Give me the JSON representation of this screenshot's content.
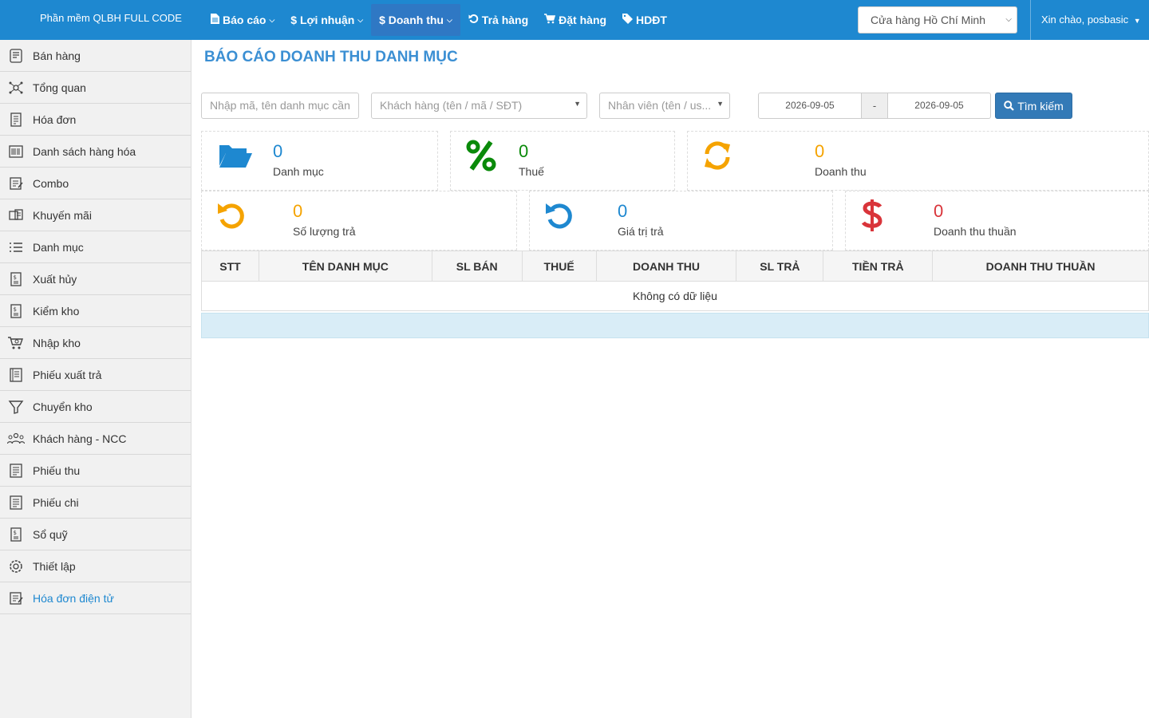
{
  "app": {
    "brand": "Phần mềm QLBH FULL CODE"
  },
  "nav": {
    "items": [
      {
        "label": "Báo cáo",
        "icon": "file-icon",
        "caret": true
      },
      {
        "label": "$ Lợi nhuận",
        "icon": "",
        "caret": true
      },
      {
        "label": "$ Doanh thu",
        "icon": "",
        "caret": true,
        "active": true
      },
      {
        "label": "Trả hàng",
        "icon": "undo-icon",
        "caret": false
      },
      {
        "label": "Đặt hàng",
        "icon": "cart-icon",
        "caret": false
      },
      {
        "label": "HDĐT",
        "icon": "tag-icon",
        "caret": false
      }
    ],
    "store": "Cửa hàng Hồ Chí Minh",
    "user_greeting": "Xin chào, posbasic"
  },
  "sidebar": {
    "items": [
      {
        "label": "Bán hàng",
        "icon": "register-icon"
      },
      {
        "label": "Tổng quan",
        "icon": "overview-icon"
      },
      {
        "label": "Hóa đơn",
        "icon": "invoice-icon"
      },
      {
        "label": "Danh sách hàng hóa",
        "icon": "barcode-icon"
      },
      {
        "label": "Combo",
        "icon": "combo-icon"
      },
      {
        "label": "Khuyến mãi",
        "icon": "promotion-icon"
      },
      {
        "label": "Danh mục",
        "icon": "list-icon"
      },
      {
        "label": "Xuất hủy",
        "icon": "export-cancel-icon"
      },
      {
        "label": "Kiểm kho",
        "icon": "stock-check-icon"
      },
      {
        "label": "Nhập kho",
        "icon": "cart-import-icon"
      },
      {
        "label": "Phiếu xuất trả",
        "icon": "return-slip-icon"
      },
      {
        "label": "Chuyển kho",
        "icon": "funnel-icon"
      },
      {
        "label": "Khách hàng - NCC",
        "icon": "customers-icon"
      },
      {
        "label": "Phiếu thu",
        "icon": "receipt-icon"
      },
      {
        "label": "Phiếu chi",
        "icon": "payment-icon"
      },
      {
        "label": "Sổ quỹ",
        "icon": "cashbook-icon"
      },
      {
        "label": "Thiết lập",
        "icon": "gear-icon"
      },
      {
        "label": "Hóa đơn điện tử",
        "icon": "e-invoice-icon",
        "active": true
      }
    ]
  },
  "page": {
    "title": "BÁO CÁO DOANH THU DANH MỤC"
  },
  "filters": {
    "category_placeholder": "Nhập mã, tên danh mục cần",
    "customer_placeholder": "Khách hàng (tên / mã / SĐT)",
    "staff_placeholder": "Nhân viên (tên / us...",
    "date_from": "2026-09-05",
    "date_separator": "-",
    "date_to": "2026-09-05",
    "search_label": "Tìm kiếm"
  },
  "stats": {
    "categories": {
      "value": "0",
      "label": "Danh mục",
      "color": "#1e88d0"
    },
    "tax": {
      "value": "0",
      "label": "Thuế",
      "color": "#0a8a0a"
    },
    "revenue": {
      "value": "0",
      "label": "Doanh thu",
      "color": "#f5a300"
    },
    "return_qty": {
      "value": "0",
      "label": "Số lượng trả",
      "color": "#f5a300"
    },
    "return_value": {
      "value": "0",
      "label": "Giá trị trả",
      "color": "#1e88d0"
    },
    "net_revenue": {
      "value": "0",
      "label": "Doanh thu thuần",
      "color": "#d9343a"
    }
  },
  "table": {
    "columns": [
      "STT",
      "TÊN DANH MỤC",
      "SL BÁN",
      "THUẾ",
      "DOANH THU",
      "SL TRẢ",
      "TIỀN TRẢ",
      "DOANH THU THUẦN"
    ],
    "empty_text": "Không có dữ liệu"
  }
}
